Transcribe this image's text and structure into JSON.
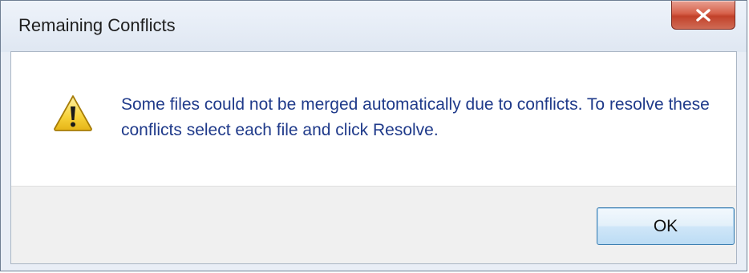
{
  "window": {
    "title": "Remaining Conflicts"
  },
  "dialog": {
    "icon": "warning-icon",
    "message": "Some files could not be merged automatically due to conflicts.  To resolve these conflicts select each file and click Resolve."
  },
  "buttons": {
    "ok_label": "OK",
    "close_icon": "close-icon"
  },
  "colors": {
    "message_text": "#1f3a8a",
    "close_button": "#c2412a",
    "ok_border": "#3c7fb1",
    "footer_bg": "#f0f0f0"
  }
}
